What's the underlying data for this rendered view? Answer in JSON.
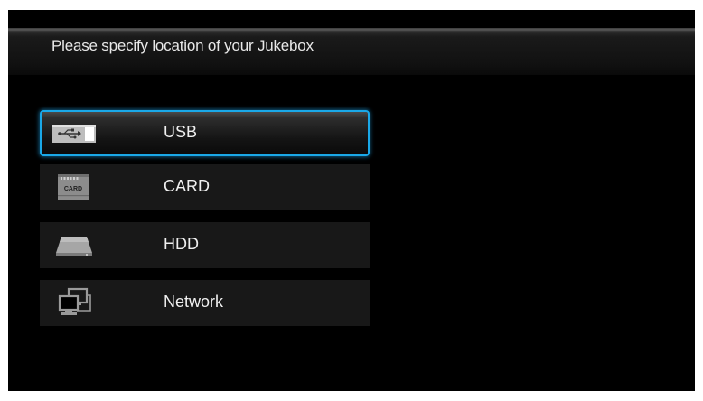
{
  "header": {
    "title": "Please specify location of your Jukebox"
  },
  "menu": {
    "items": [
      {
        "label": "USB",
        "icon": "usb-icon",
        "selected": true
      },
      {
        "label": "CARD",
        "icon": "sd-card-icon",
        "icon_text": "CARD",
        "selected": false
      },
      {
        "label": "HDD",
        "icon": "hard-drive-icon",
        "selected": false
      },
      {
        "label": "Network",
        "icon": "network-computers-icon",
        "selected": false
      }
    ]
  },
  "colors": {
    "background": "#000000",
    "selection_border": "#1aa8e8",
    "item_background": "#181818",
    "text": "#f0f0f0"
  }
}
